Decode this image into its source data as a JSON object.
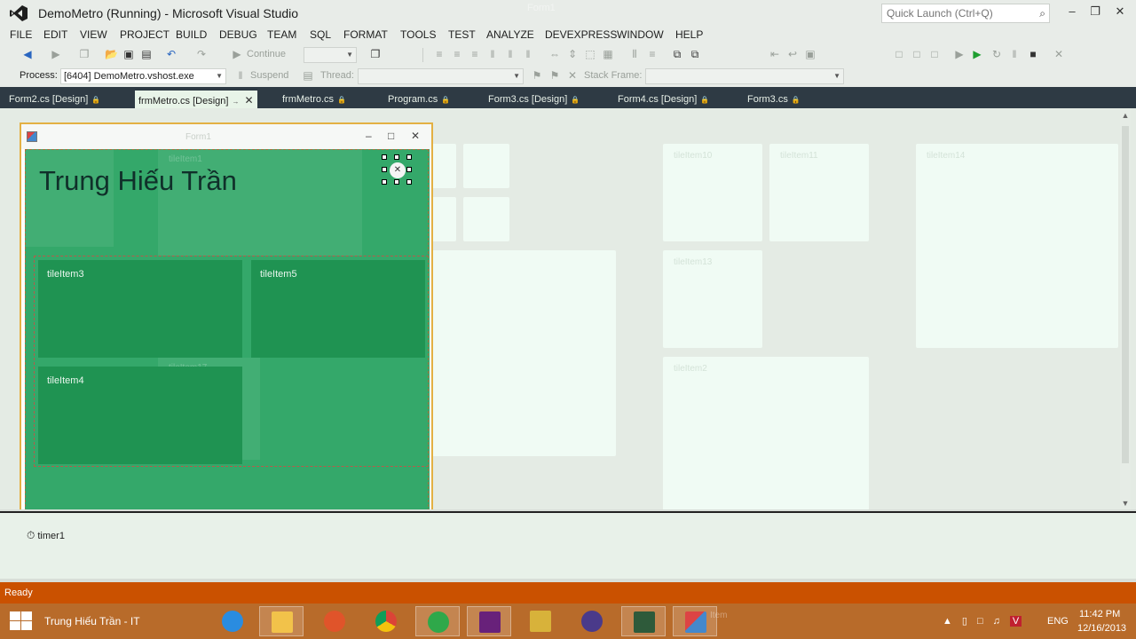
{
  "window": {
    "title": "DemoMetro (Running) - Microsoft Visual Studio",
    "ghost_title": "Form1",
    "quick_launch_placeholder": "Quick Launch (Ctrl+Q)"
  },
  "menu": [
    "FILE",
    "EDIT",
    "VIEW",
    "PROJECT",
    "BUILD",
    "DEBUG",
    "TEAM",
    "SQL",
    "FORMAT",
    "TOOLS",
    "TEST",
    "ANALYZE",
    "DEVEXPRESS",
    "WINDOW",
    "HELP"
  ],
  "toolbar": {
    "continue_label": "Continue",
    "process_label": "Process:",
    "process_value": "[6404] DemoMetro.vshost.exe",
    "suspend_label": "Suspend",
    "thread_label": "Thread:",
    "stack_frame_label": "Stack Frame:"
  },
  "tabs": [
    {
      "label": "Form2.cs [Design]",
      "active": false
    },
    {
      "label": "frmMetro.cs [Design]",
      "active": true
    },
    {
      "label": "frmMetro.cs",
      "active": false
    },
    {
      "label": "Program.cs",
      "active": false
    },
    {
      "label": "Form3.cs [Design]",
      "active": false
    },
    {
      "label": "Form4.cs [Design]",
      "active": false
    },
    {
      "label": "Form3.cs",
      "active": false
    }
  ],
  "background_tiles": [
    "tileItem10",
    "tileItem11",
    "tileItem14",
    "tileItem13",
    "tileItem2",
    "tileItem1"
  ],
  "form": {
    "title": "Form1",
    "header_text": "Trung Hiếu Trần",
    "ghost_tile_labels": [
      "tileItem1",
      "tileItem17"
    ],
    "tiles": [
      {
        "label": "tileItem3"
      },
      {
        "label": "tileItem5"
      },
      {
        "label": "tileItem4"
      }
    ]
  },
  "tray": {
    "timer_label": "timer1"
  },
  "status": {
    "text": "Ready"
  },
  "taskbar": {
    "active_title": "Trung Hiếu Trần - IT",
    "language": "ENG",
    "time": "11:42 PM",
    "date": "12/16/2013",
    "ghost_item": "Item"
  },
  "colors": {
    "accent_status": "#ca5100",
    "form_tile_bg": "#34a86a",
    "tile_green": "#1f9352",
    "tab_strip": "#2e3a44"
  }
}
